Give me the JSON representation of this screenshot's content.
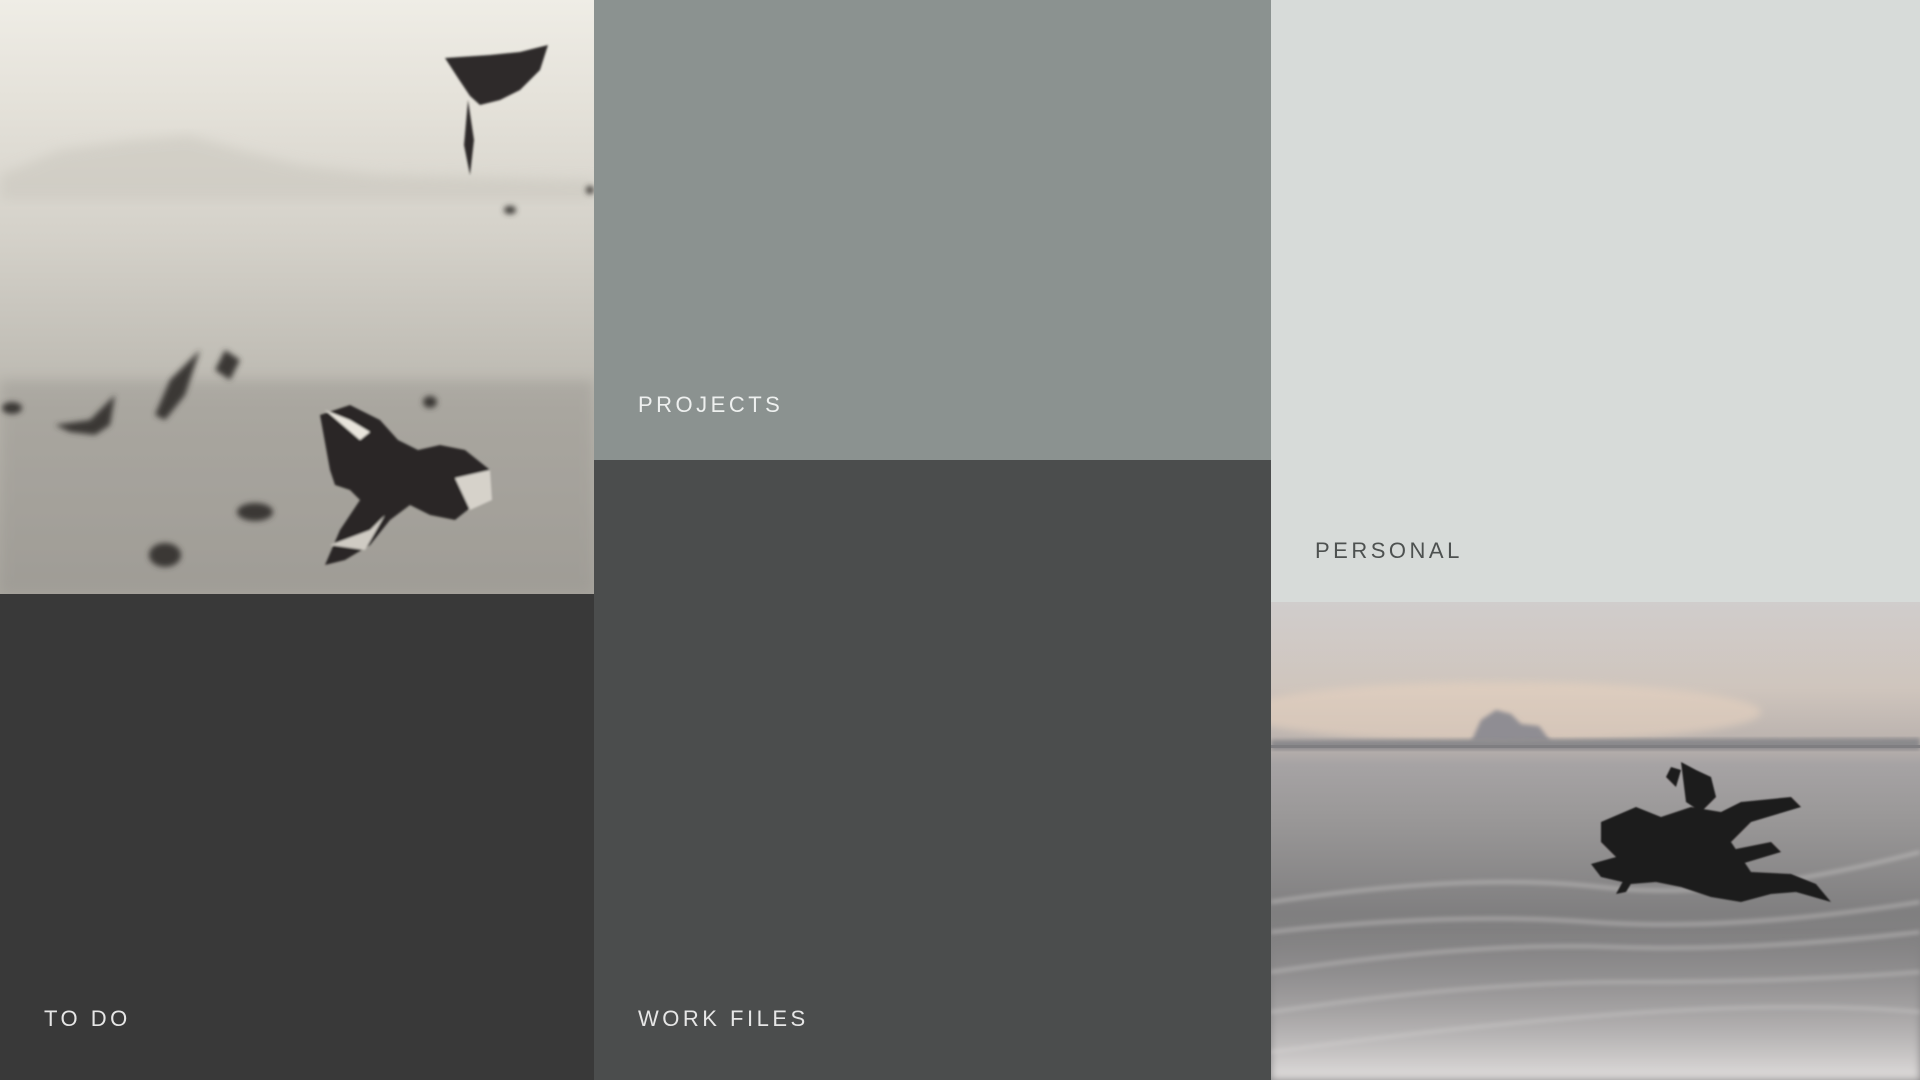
{
  "tiles": {
    "todo": {
      "label": "TO DO"
    },
    "projects": {
      "label": "PROJECTS"
    },
    "work_files": {
      "label": "WORK FILES"
    },
    "personal": {
      "label": "PERSONAL"
    }
  },
  "colors": {
    "todo_bg": "#393939",
    "projects_bg": "#8b9290",
    "work_files_bg": "#4b4d4d",
    "personal_bg": "#d7dbd9"
  },
  "images": {
    "birds": "seagulls-over-water-photo",
    "sea": "driftwood-in-surf-photo"
  }
}
